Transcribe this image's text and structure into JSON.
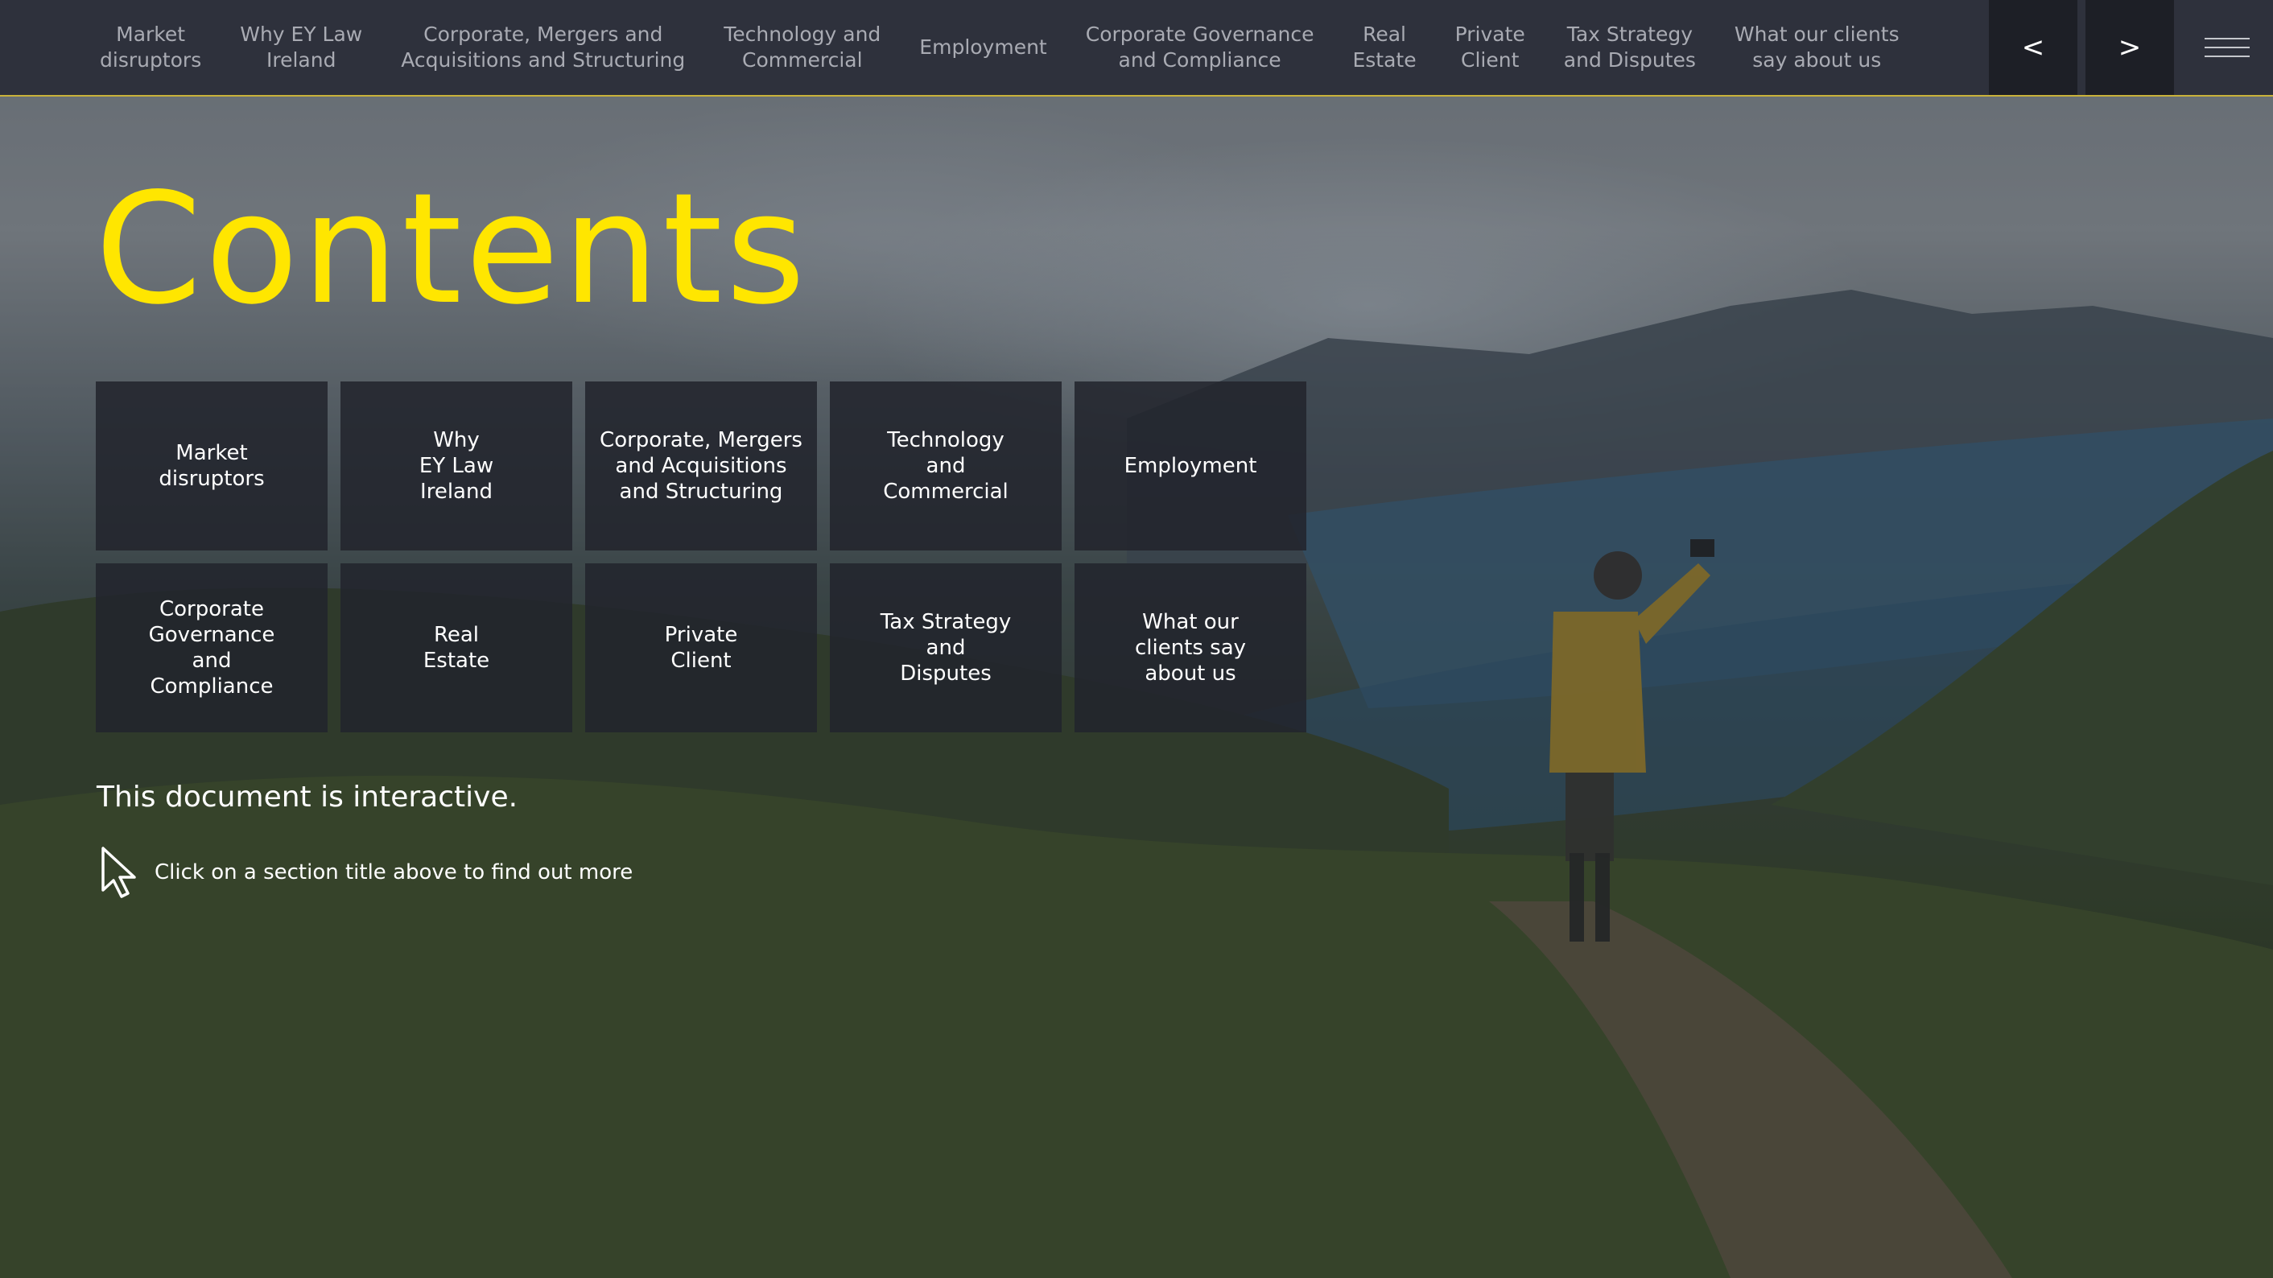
{
  "colors": {
    "accent": "#ffe600",
    "topbar_background": "#2e313c",
    "topbar_border": "#c9b23a",
    "tile_background": "#22242c",
    "nav_text": "#a9abb3",
    "text": "#ffffff"
  },
  "nav": {
    "items": [
      "Market\ndisruptors",
      "Why EY Law\nIreland",
      "Corporate, Mergers and\nAcquisitions and Structuring",
      "Technology and\nCommercial",
      "Employment",
      "Corporate Governance\nand Compliance",
      "Real\nEstate",
      "Private\nClient",
      "Tax Strategy\nand Disputes",
      "What our clients\nsay about us"
    ],
    "prev_label": "<",
    "next_label": ">",
    "menu_icon": "hamburger-menu-icon"
  },
  "main": {
    "title": "Contents",
    "tiles": [
      "Market\ndisruptors",
      "Why\nEY Law\nIreland",
      "Corporate, Mergers\nand Acquisitions\nand Structuring",
      "Technology\nand\nCommercial",
      "Employment",
      "Corporate\nGovernance\nand\nCompliance",
      "Real\nEstate",
      "Private\nClient",
      "Tax Strategy\nand\nDisputes",
      "What our\nclients say\nabout us"
    ],
    "interactive_note": "This document is interactive.",
    "hint_icon": "mouse-pointer-icon",
    "hint_text": "Click on a section title above to find out more"
  }
}
